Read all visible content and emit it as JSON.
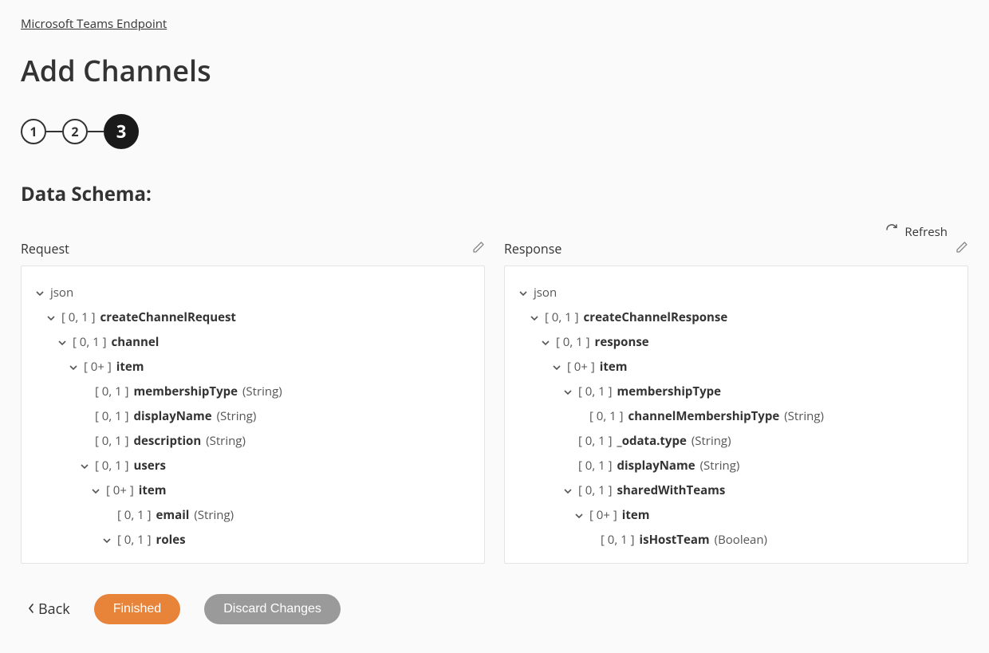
{
  "breadcrumb": "Microsoft Teams Endpoint",
  "page_title": "Add Channels",
  "stepper": {
    "steps": [
      "1",
      "2",
      "3"
    ],
    "active_index": 2
  },
  "section_title": "Data Schema:",
  "refresh_label": "Refresh",
  "columns": {
    "request": {
      "title": "Request"
    },
    "response": {
      "title": "Response"
    }
  },
  "request_tree": {
    "root": "json",
    "l1_card": "[ 0, 1 ]",
    "l1_name": "createChannelRequest",
    "l2_card": "[ 0, 1 ]",
    "l2_name": "channel",
    "l3_card": "[ 0+ ]",
    "l3_name": "item",
    "f1_card": "[ 0, 1 ]",
    "f1_name": "membershipType",
    "f1_type": "(String)",
    "f2_card": "[ 0, 1 ]",
    "f2_name": "displayName",
    "f2_type": "(String)",
    "f3_card": "[ 0, 1 ]",
    "f3_name": "description",
    "f3_type": "(String)",
    "l4_card": "[ 0, 1 ]",
    "l4_name": "users",
    "l5_card": "[ 0+ ]",
    "l5_name": "item",
    "f4_card": "[ 0, 1 ]",
    "f4_name": "email",
    "f4_type": "(String)",
    "l6_card": "[ 0, 1 ]",
    "l6_name": "roles"
  },
  "response_tree": {
    "root": "json",
    "l1_card": "[ 0, 1 ]",
    "l1_name": "createChannelResponse",
    "l2_card": "[ 0, 1 ]",
    "l2_name": "response",
    "l3_card": "[ 0+ ]",
    "l3_name": "item",
    "l4_card": "[ 0, 1 ]",
    "l4_name": "membershipType",
    "f1_card": "[ 0, 1 ]",
    "f1_name": "channelMembershipType",
    "f1_type": "(String)",
    "f2_card": "[ 0, 1 ]",
    "f2_name": "_odata.type",
    "f2_type": "(String)",
    "f3_card": "[ 0, 1 ]",
    "f3_name": "displayName",
    "f3_type": "(String)",
    "l5_card": "[ 0, 1 ]",
    "l5_name": "sharedWithTeams",
    "l6_card": "[ 0+ ]",
    "l6_name": "item",
    "f4_card": "[ 0, 1 ]",
    "f4_name": "isHostTeam",
    "f4_type": "(Boolean)"
  },
  "footer": {
    "back": "Back",
    "finished": "Finished",
    "discard": "Discard Changes"
  }
}
